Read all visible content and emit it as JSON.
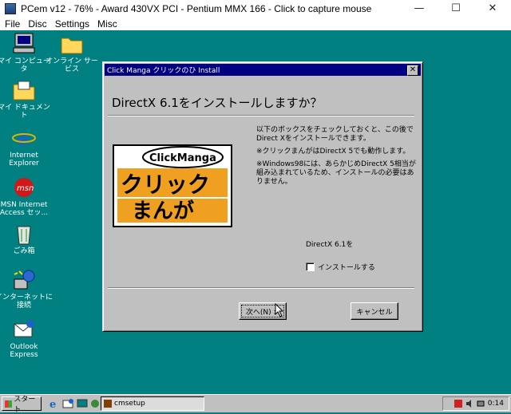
{
  "host": {
    "title": "PCem v12 - 76% - Award 430VX PCI - Pentium MMX 166 - Click to capture mouse",
    "minimize": "—",
    "maximize": "☐",
    "close": "✕",
    "menu": [
      "File",
      "Disc",
      "Settings",
      "Misc"
    ]
  },
  "desktop": {
    "icons": [
      {
        "name": "my-computer",
        "label": "マイ コンピュータ"
      },
      {
        "name": "online-services",
        "label": "オンライン サービス"
      },
      {
        "name": "my-documents",
        "label": "マイ ドキュメント"
      },
      {
        "name": "internet-explorer",
        "label": "Internet Explorer"
      },
      {
        "name": "msn",
        "label": "MSN Internet Access セッ..."
      },
      {
        "name": "recycle-bin",
        "label": "ごみ箱"
      },
      {
        "name": "connect-internet",
        "label": "インターネットに 接続"
      },
      {
        "name": "outlook-express",
        "label": "Outlook Express"
      }
    ]
  },
  "dialog": {
    "title": "Click Manga クリックのひ Install",
    "close": "✕",
    "heading": "DirectX 6.1をインストールしますか？",
    "logo_bubble": "ClickManga",
    "logo_line1": "クリック",
    "logo_line2": "まんが",
    "body": [
      "以下のボックスをチェックしておくと、この後で Direct Xをインストールできます。",
      "※クリックまんがはDirectX 5でも動作します。",
      "※Windows98には、あらかじめDirectX 5相当が組み込まれているため、インストールの必要はありません。"
    ],
    "dx_label": "DirectX 6.1を",
    "checkbox_label": "インストールする",
    "checkbox_checked": false,
    "next_button": "次へ(N) >",
    "cancel_button": "キャンセル"
  },
  "taskbar": {
    "start": "スタート",
    "task": "cmsetup",
    "clock": "0:14"
  }
}
